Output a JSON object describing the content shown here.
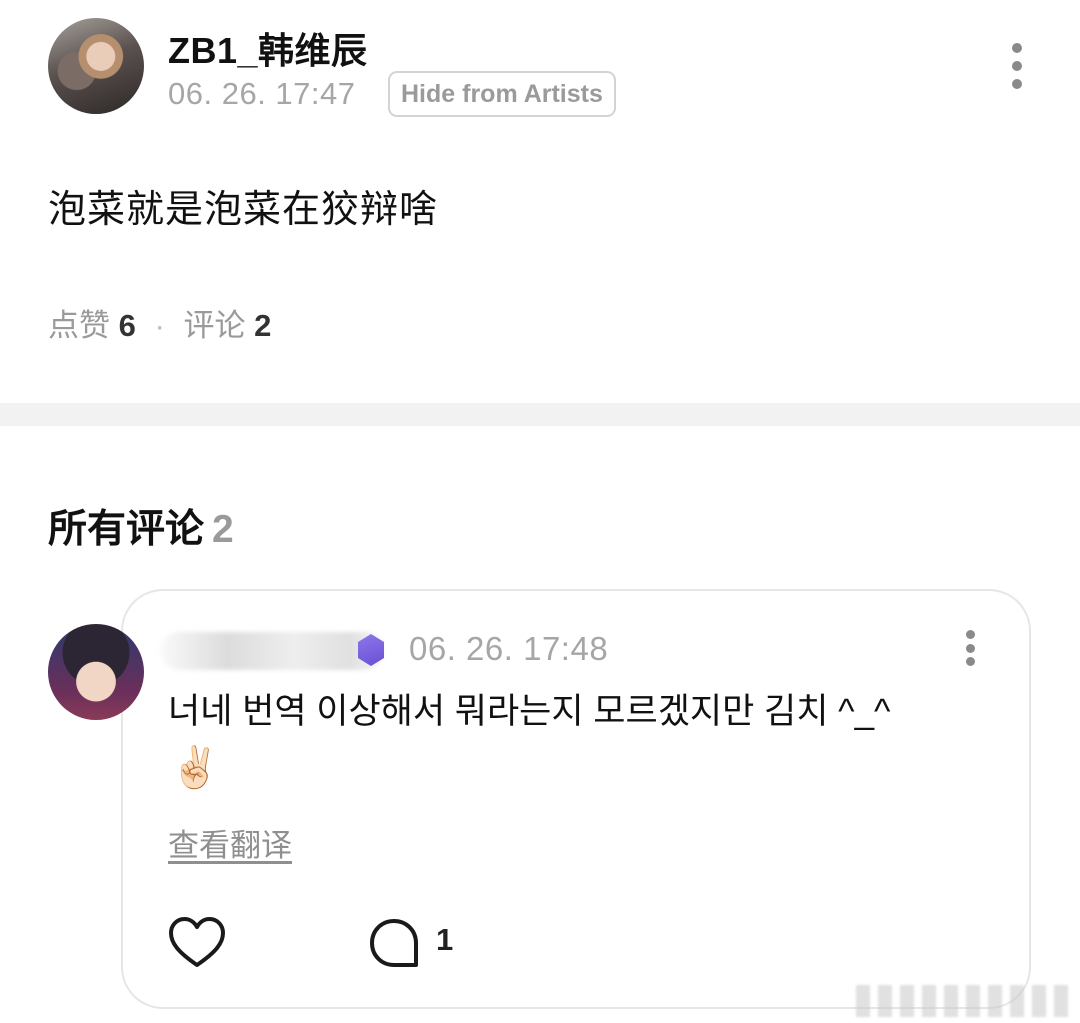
{
  "post": {
    "author": "ZB1_韩维辰",
    "time": "06. 26. 17:47",
    "hide_label": "Hide from Artists",
    "body": "泡菜就是泡菜在狡辩啥",
    "stats": {
      "likes_label": "点赞",
      "likes_count": "6",
      "comments_label": "评论",
      "comments_count": "2",
      "separator": "·"
    }
  },
  "comments_section": {
    "title": "所有评论",
    "count": "2"
  },
  "comment": {
    "author": "",
    "time": "06. 26. 17:48",
    "text": "너네 번역 이상해서 뭐라는지 모르겠지만 김치 ^_^",
    "emoji": "✌🏻",
    "translate_label": "查看翻译",
    "reply_count": "1"
  },
  "icons": {
    "more": "more-vertical-icon",
    "like": "heart-icon",
    "reply": "speech-bubble-icon"
  },
  "colors": {
    "muted_text": "#a6a6a6",
    "divider": "#f2f2f2",
    "card_border": "#e6e6e6",
    "badge": "#6b4fd4"
  }
}
